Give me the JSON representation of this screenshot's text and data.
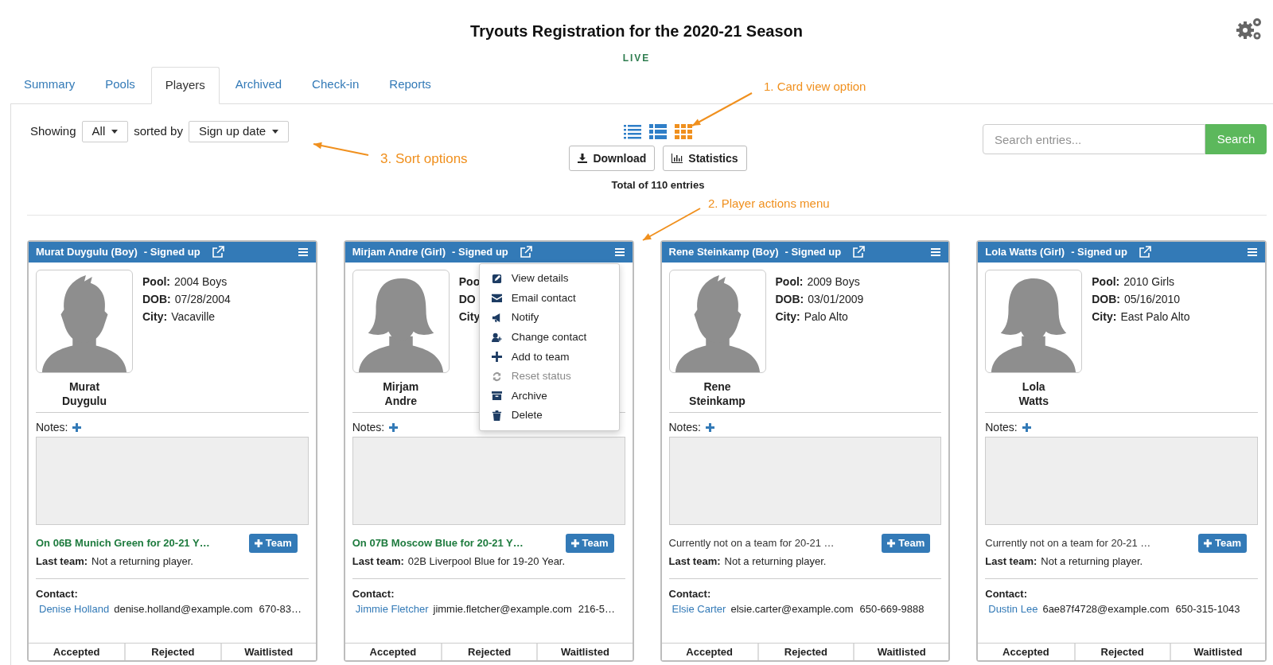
{
  "title": "Tryouts Registration for the 2020-21 Season",
  "status_label": "LIVE",
  "tabs": [
    {
      "label": "Summary",
      "selected": false
    },
    {
      "label": "Pools",
      "selected": false
    },
    {
      "label": "Players",
      "selected": true
    },
    {
      "label": "Archived",
      "selected": false
    },
    {
      "label": "Check-in",
      "selected": false
    },
    {
      "label": "Reports",
      "selected": false
    }
  ],
  "toolbar": {
    "showing_label": "Showing",
    "filter": "All",
    "sorted_by_label": "sorted by",
    "sort": "Sign up date",
    "view_options": [
      {
        "selected": false
      },
      {
        "selected": false
      },
      {
        "selected": true
      }
    ],
    "buttons": [
      "Download",
      "Statistics"
    ],
    "total": "Total of 110 entries",
    "search": {
      "placeholder": "Search entries...",
      "button": "Search"
    }
  },
  "annotations": [
    "1. Card view option",
    "2. Player actions menu",
    "3. Sort options"
  ],
  "cards": [
    {
      "header": "Murat Duygulu (Boy)",
      "status": "- Signed up",
      "avatar": {
        "kind": "boy"
      },
      "caption": [
        "Murat",
        "Duygulu"
      ],
      "details": [
        {
          "label": "Pool:",
          "value": "2004 Boys"
        },
        {
          "label": "DOB:",
          "value": "07/28/2004"
        },
        {
          "label": "City:",
          "value": "Vacaville"
        }
      ],
      "notes_label": "Notes:",
      "team": "On 06B Munich Green for 20-21 Y…",
      "on_team": true,
      "team_button": "Team",
      "last_team_label": "Last team:",
      "last_team": "Not a returning player.",
      "contact_label": "Contact:",
      "contact_name": "Denise Holland",
      "contact_email": "denise.holland@example.com",
      "contact_phone": "670-83…",
      "decisions": [
        "Accepted",
        "Rejected",
        "Waitlisted"
      ]
    },
    {
      "header": "Mirjam Andre (Girl)",
      "status": "- Signed up",
      "avatar": {
        "kind": "girl"
      },
      "caption": [
        "Mirjam",
        "Andre"
      ],
      "details": [
        {
          "label": "Poo"
        },
        {
          "label": "DO"
        },
        {
          "label": "City"
        }
      ],
      "notes_label": "Notes:",
      "team": "On 07B Moscow Blue for 20-21 Y…",
      "on_team": true,
      "team_button": "Team",
      "last_team_label": "Last team:",
      "last_team": "02B Liverpool Blue for 19-20 Year.",
      "contact_label": "Contact:",
      "contact_name": "Jimmie Fletcher",
      "contact_email": "jimmie.fletcher@example.com",
      "contact_phone": "216-5…",
      "decisions": [
        "Accepted",
        "Rejected",
        "Waitlisted"
      ],
      "actions_menu": [
        {
          "label": "View details",
          "disabled": false
        },
        {
          "label": "Email contact",
          "disabled": false
        },
        {
          "label": "Notify",
          "disabled": false
        },
        {
          "label": "Change contact",
          "disabled": false
        },
        {
          "label": "Add to team",
          "disabled": false
        },
        {
          "label": "Reset status",
          "disabled": true
        },
        {
          "label": "Archive",
          "disabled": false
        },
        {
          "label": "Delete",
          "disabled": false
        }
      ]
    },
    {
      "header": "Rene Steinkamp (Boy)",
      "status": "- Signed up",
      "avatar": {
        "kind": "boy"
      },
      "caption": [
        "Rene",
        "Steinkamp"
      ],
      "details": [
        {
          "label": "Pool:",
          "value": "2009 Boys"
        },
        {
          "label": "DOB:",
          "value": "03/01/2009"
        },
        {
          "label": "City:",
          "value": "Palo Alto"
        }
      ],
      "notes_label": "Notes:",
      "team": "Currently not on a team for 20-21 …",
      "on_team": false,
      "team_button": "Team",
      "last_team_label": "Last team:",
      "last_team": "Not a returning player.",
      "contact_label": "Contact:",
      "contact_name": "Elsie Carter",
      "contact_email": "elsie.carter@example.com",
      "contact_phone": "650-669-9888",
      "decisions": [
        "Accepted",
        "Rejected",
        "Waitlisted"
      ]
    },
    {
      "header": "Lola Watts (Girl)",
      "status": "- Signed up",
      "avatar": {
        "kind": "girl"
      },
      "caption": [
        "Lola",
        "Watts"
      ],
      "details": [
        {
          "label": "Pool:",
          "value": "2010 Girls"
        },
        {
          "label": "DOB:",
          "value": "05/16/2010"
        },
        {
          "label": "City:",
          "value": "East Palo Alto"
        }
      ],
      "notes_label": "Notes:",
      "team": "Currently not on a team for 20-21 …",
      "on_team": false,
      "team_button": "Team",
      "last_team_label": "Last team:",
      "last_team": "Not a returning player.",
      "contact_label": "Contact:",
      "contact_name": "Dustin Lee",
      "contact_email": "6ae87f4728@example.com",
      "contact_phone": "650-315-1043",
      "decisions": [
        "Accepted",
        "Rejected",
        "Waitlisted"
      ]
    }
  ]
}
